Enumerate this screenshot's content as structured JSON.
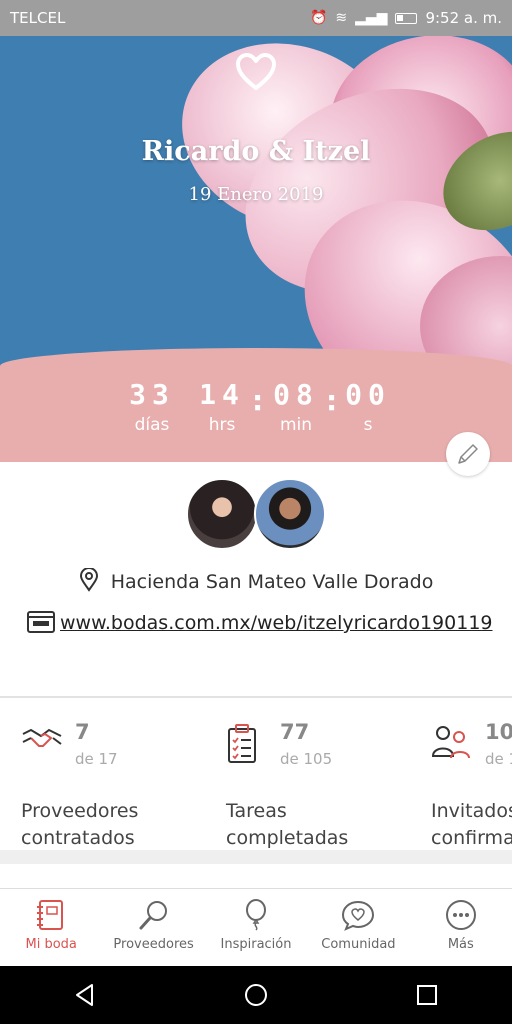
{
  "status_bar": {
    "carrier": "TELCEL",
    "time": "9:52 a. m."
  },
  "hero": {
    "names": "Ricardo & Itzel",
    "date": "19 Enero 2019"
  },
  "countdown": {
    "days": "33",
    "days_label": "días",
    "hours": "14",
    "hours_label": "hrs",
    "minutes": "08",
    "minutes_label": "min",
    "seconds": "00",
    "seconds_label": "s",
    "separator": ":"
  },
  "info": {
    "venue": "Hacienda San Mateo Valle Dorado",
    "website": "www.bodas.com.mx/web/itzelyricardo190119"
  },
  "stats": [
    {
      "value": "7",
      "total": "de 17",
      "label": "Proveedores contratados",
      "icon": "handshake-icon"
    },
    {
      "value": "77",
      "total": "de 105",
      "label": "Tareas completadas",
      "icon": "clipboard-icon"
    },
    {
      "value": "10",
      "total": "de 1",
      "label": "Invitados confirma",
      "icon": "guests-icon"
    }
  ],
  "bottom_nav": [
    {
      "label": "Mi boda",
      "icon": "notebook-icon",
      "active": true
    },
    {
      "label": "Proveedores",
      "icon": "search-icon",
      "active": false
    },
    {
      "label": "Inspiración",
      "icon": "balloon-icon",
      "active": false
    },
    {
      "label": "Comunidad",
      "icon": "chat-heart-icon",
      "active": false
    },
    {
      "label": "Más",
      "icon": "more-icon",
      "active": false
    }
  ],
  "colors": {
    "accent": "#d9534f",
    "countdown_bg": "#e8aeae",
    "sky": "#3f7eb0"
  }
}
